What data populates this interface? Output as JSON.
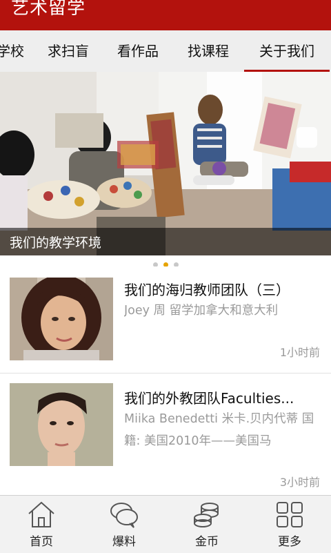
{
  "header": {
    "title": "艺术留学"
  },
  "tabs": [
    {
      "label": "学校"
    },
    {
      "label": "求扫盲"
    },
    {
      "label": "看作品"
    },
    {
      "label": "找课程"
    },
    {
      "label": "关于我们"
    }
  ],
  "banner": {
    "caption": "我们的教学环境",
    "page_count": 3,
    "active_index": 1
  },
  "articles": [
    {
      "title": "我们的海归教师团队（三）",
      "desc": "Joey 周 留学加拿大和意大利",
      "time": "1小时前"
    },
    {
      "title": "我们的外教团队Faculties...",
      "desc": "Miika Benedetti 米卡.贝内代蒂 国籍: 美国2010年——美国马",
      "time": "3小时前"
    }
  ],
  "bottom_nav": [
    {
      "label": "首页",
      "icon": "home-icon"
    },
    {
      "label": "爆料",
      "icon": "chat-bubble-icon"
    },
    {
      "label": "金币",
      "icon": "coins-icon"
    },
    {
      "label": "更多",
      "icon": "grid-icon"
    }
  ],
  "colors": {
    "brand": "#b3120d",
    "active_dot": "#e6a400"
  }
}
